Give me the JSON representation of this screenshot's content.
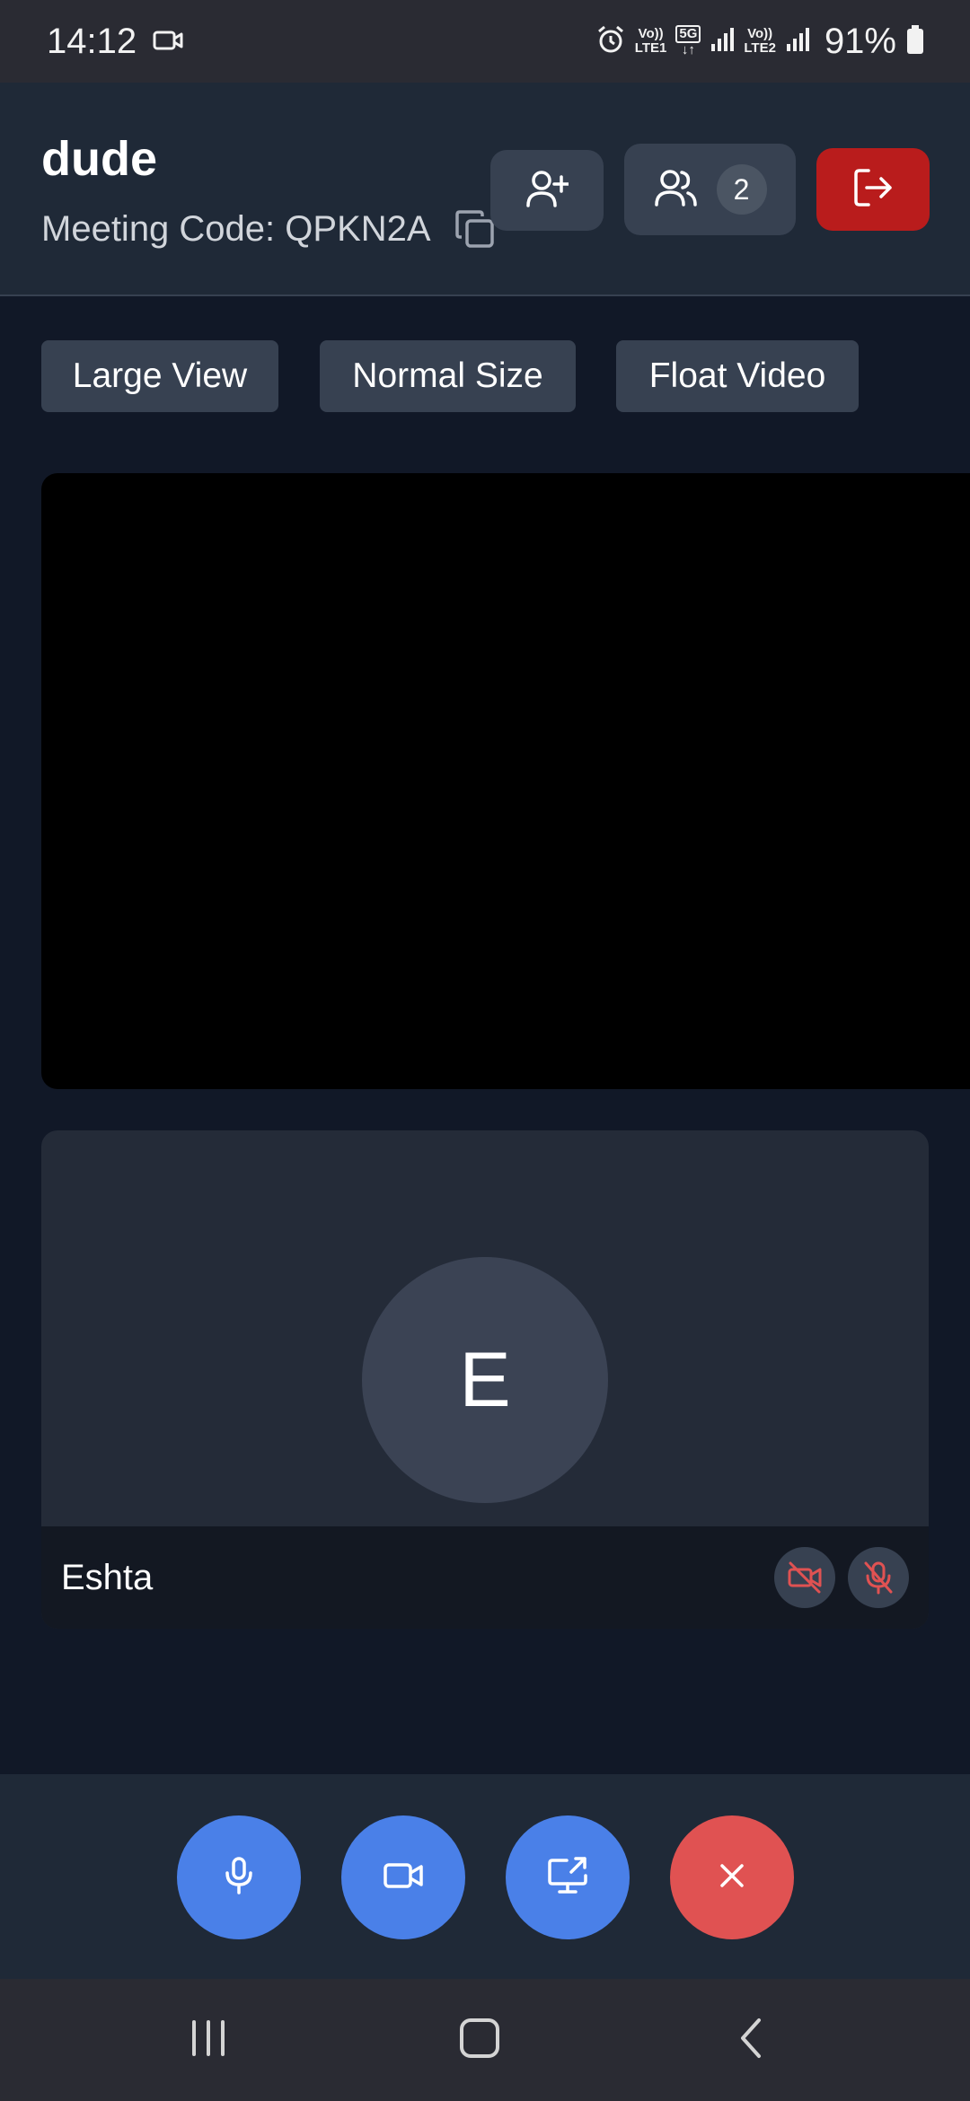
{
  "status_bar": {
    "time": "14:12",
    "net1": [
      "Vo))",
      "LTE1"
    ],
    "net_5g": "5G",
    "net2": [
      "Vo))",
      "LTE2"
    ],
    "battery": "91%"
  },
  "header": {
    "title": "dude",
    "meeting_code": "Meeting Code: QPKN2A",
    "participant_count": "2",
    "leave_color": "#b91c1c"
  },
  "view_options": [
    "Large View",
    "Normal Size",
    "Float Video"
  ],
  "participant": {
    "initial": "E",
    "name": "Eshta",
    "camera": "off",
    "mic": "off"
  },
  "controls": {
    "mic_color": "#4a80e8",
    "camera_color": "#4a80e8",
    "share_color": "#4a80e8",
    "end_color": "#e05252"
  },
  "icons": [
    "video-recording-icon",
    "alarm-icon",
    "signal-icon",
    "battery-icon",
    "copy-icon",
    "add-person-icon",
    "participants-icon",
    "leave-icon",
    "camera-off-icon",
    "mic-off-icon",
    "microphone-icon",
    "video-camera-icon",
    "screen-share-icon",
    "close-icon",
    "recents-icon",
    "home-icon",
    "back-icon"
  ]
}
